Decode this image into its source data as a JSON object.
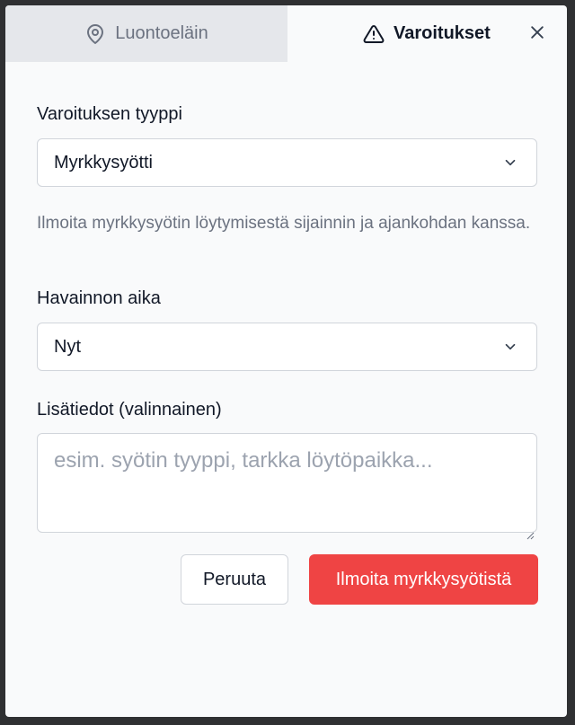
{
  "tabs": [
    {
      "label": "Luontoeläin",
      "icon": "map-pin-icon",
      "active": false
    },
    {
      "label": "Varoitukset",
      "icon": "warning-triangle-icon",
      "active": true
    }
  ],
  "close": {
    "icon": "close-icon"
  },
  "form": {
    "warning_type_label": "Varoituksen tyyppi",
    "warning_type_value": "Myrkkysyötti",
    "help_text": "Ilmoita myrkkysyötin löytymisestä sijainnin ja ajankohdan kanssa.",
    "observation_time_label": "Havainnon aika",
    "observation_time_value": "Nyt",
    "details_label": "Lisätiedot (valinnainen)",
    "details_placeholder": "esim. syötin tyyppi, tarkka löytöpaikka..."
  },
  "actions": {
    "cancel_label": "Peruuta",
    "submit_label": "Ilmoita myrkkysyötistä"
  },
  "colors": {
    "accent": "#ef4444",
    "muted_text": "#6b7280",
    "inactive_tab": "#e5e7eb"
  }
}
